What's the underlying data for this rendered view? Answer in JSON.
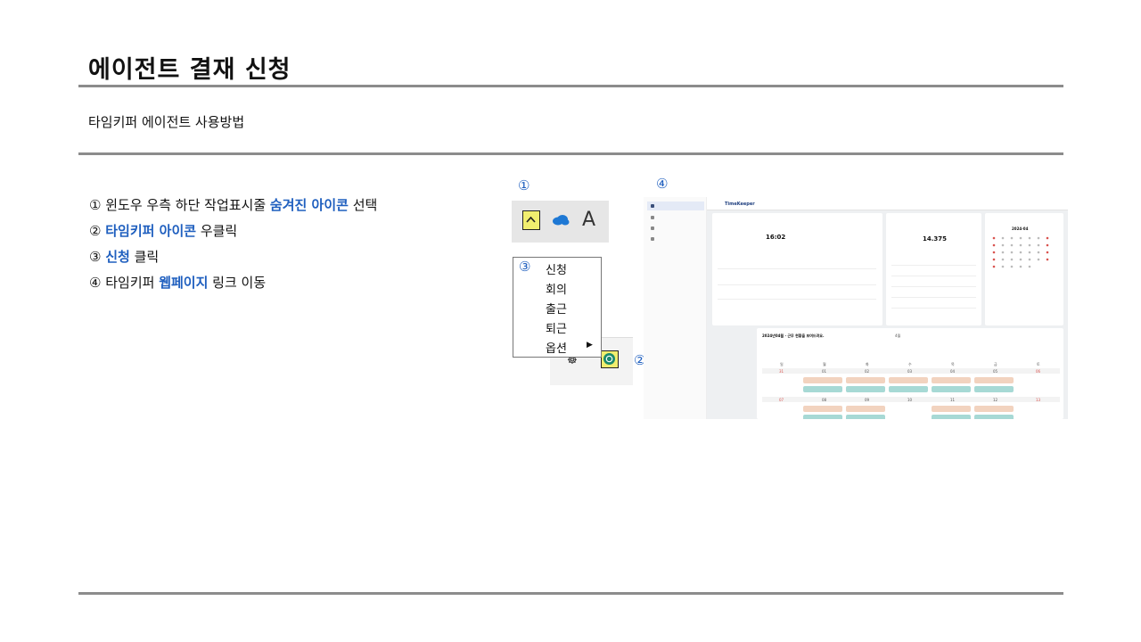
{
  "page": {
    "title": "에이전트 결재 신청",
    "subtitle": "타임키퍼 에이전트 사용방법"
  },
  "steps": [
    {
      "num": "①",
      "before": "윈도우 우측 하단 작업표시줄 ",
      "highlight": "숨겨진 아이콘",
      "after": " 선택"
    },
    {
      "num": "②",
      "before": "",
      "highlight": "타임키퍼 아이콘",
      "after": " 우클릭"
    },
    {
      "num": "③",
      "before": "",
      "highlight": "신청",
      "after": " 클릭"
    },
    {
      "num": "④",
      "before": "타임키퍼 ",
      "highlight": "웹페이지",
      "after": " 링크 이동"
    }
  ],
  "markers": {
    "m1": "①",
    "m2": "②",
    "m3": "③",
    "m4": "④"
  },
  "tray": {
    "letter": "A",
    "icons": [
      "chevron-up-icon",
      "onedrive-cloud-icon"
    ]
  },
  "context_menu": {
    "items": [
      "신청",
      "회의",
      "출근",
      "퇴근",
      "옵션"
    ]
  },
  "webpage": {
    "logo": "TimeKeeper",
    "time": "16:02",
    "amount": "14.375",
    "month_label": "2024-04",
    "board_title": "2024년04월 · 근무 현황을 보여드려요.",
    "board_month": "4월",
    "weekdays": [
      "일",
      "월",
      "화",
      "수",
      "목",
      "금",
      "토"
    ],
    "week1": [
      "31",
      "01",
      "02",
      "03",
      "04",
      "05",
      "06"
    ],
    "week2": [
      "07",
      "08",
      "09",
      "10",
      "11",
      "12",
      "13"
    ]
  },
  "colors": {
    "accent": "#1f5fbf",
    "highlight_box": "#f1ee6f",
    "rule": "#8c8c8c"
  }
}
